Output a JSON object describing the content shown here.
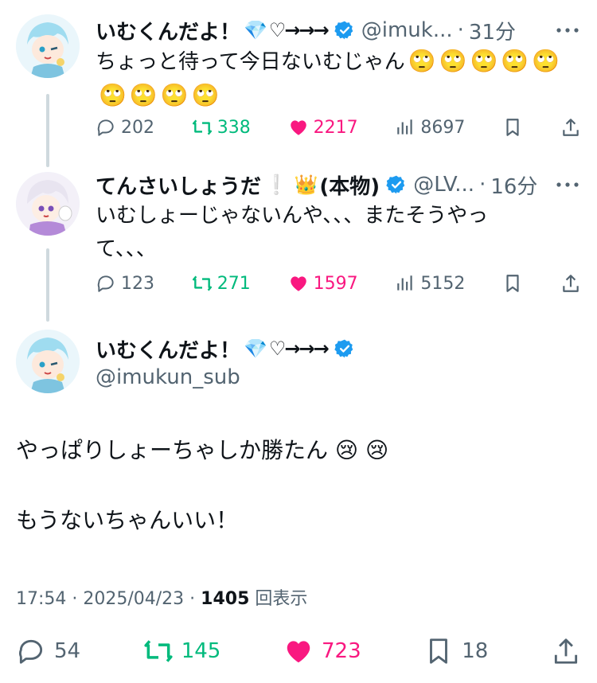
{
  "tweets": [
    {
      "name": "いむくんだよ！",
      "name_emoji": "💎",
      "name_suffix": "♡→→→",
      "handle": "@imuk...",
      "time": "31分",
      "text": "ちょっと待って今日ないむじゃん",
      "emoji_faces": [
        "🙄",
        "🙄",
        "🙄",
        "🙄",
        "🙄",
        "🙄",
        "🙄",
        "🙄",
        "🙄"
      ],
      "replies": "202",
      "retweets": "338",
      "likes": "2217",
      "views": "8697"
    },
    {
      "name": "てんさいしょうだ",
      "name_emoji": "❕ 👑",
      "name_suffix": "(本物)",
      "handle": "@LV...",
      "time": "16分",
      "text_line1": "いむしょーじゃないんや、、、またそうやっ",
      "text_line2": "て、、、",
      "replies": "123",
      "retweets": "271",
      "likes": "1597",
      "views": "5152"
    }
  ],
  "main": {
    "name": "いむくんだよ！",
    "name_emoji": "💎",
    "name_suffix": "♡→→→",
    "handle": "@imukun_sub",
    "text_line1": "やっぱりしょーちゃしか勝たん",
    "text_emoji": "😢 😢",
    "text_line2": "もうないちゃんいい！",
    "timestamp": "17:54 · 2025/04/23 · ",
    "views": "1405",
    "views_label": "回表示",
    "replies": "54",
    "retweets": "145",
    "likes": "723",
    "bookmarks": "18"
  },
  "colors": {
    "retweet": "#00ba7c",
    "like": "#f91880",
    "verified": "#1d9bf0",
    "muted": "#536471"
  }
}
